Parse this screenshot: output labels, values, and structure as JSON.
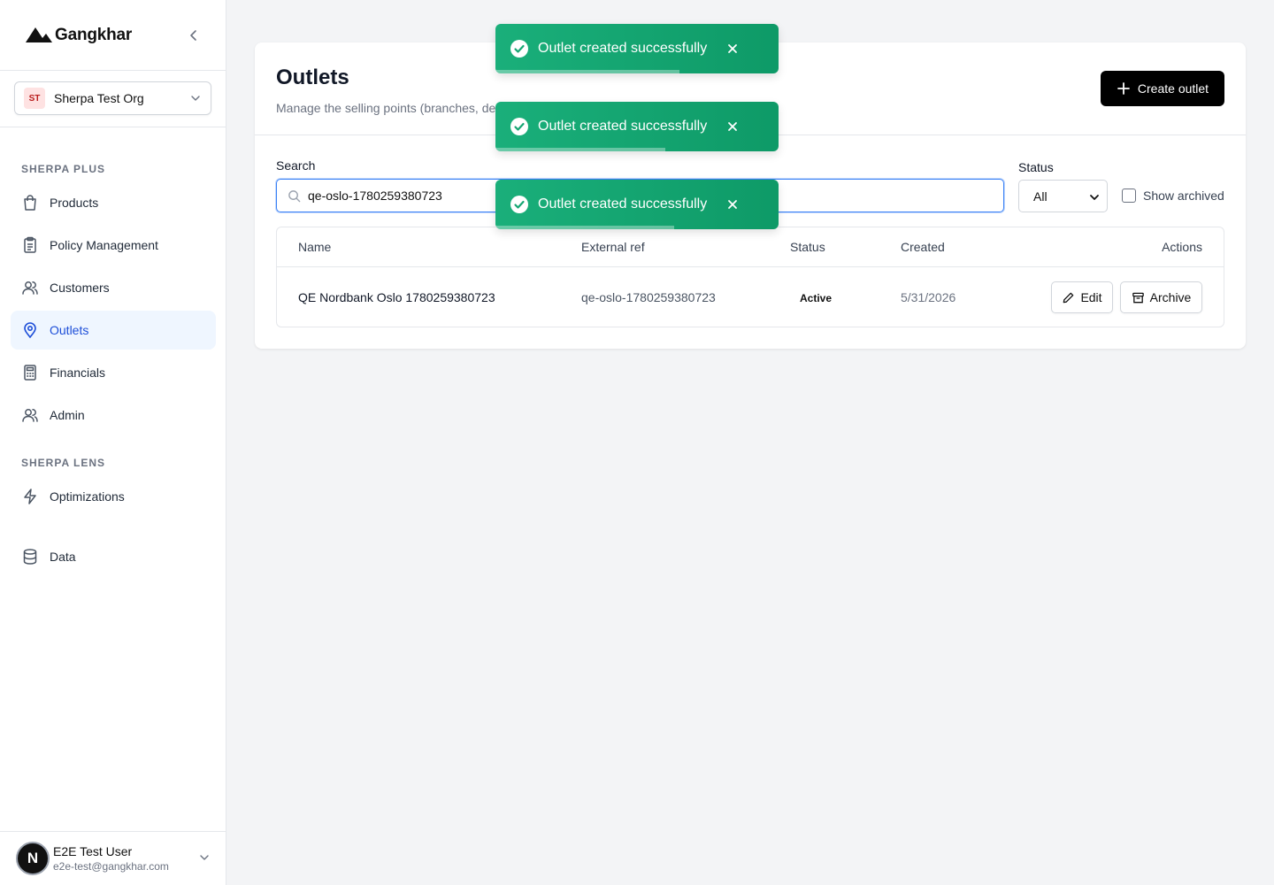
{
  "brand": {
    "name": "Gangkhar"
  },
  "org": {
    "initials": "ST",
    "name": "Sherpa Test Org"
  },
  "sidebar": {
    "sections": [
      {
        "label": "SHERPA PLUS"
      },
      {
        "label": "SHERPA LENS"
      }
    ],
    "items": [
      {
        "label": "Products",
        "icon": "shopping-bag-icon"
      },
      {
        "label": "Policy Management",
        "icon": "clipboard-icon"
      },
      {
        "label": "Customers",
        "icon": "users-icon"
      },
      {
        "label": "Outlets",
        "icon": "map-pin-icon",
        "active": true
      },
      {
        "label": "Financials",
        "icon": "calculator-icon"
      },
      {
        "label": "Admin",
        "icon": "users-icon"
      },
      {
        "label": "Optimizations",
        "icon": "lightning-icon"
      },
      {
        "label": "Data",
        "icon": "database-icon"
      }
    ]
  },
  "user": {
    "initial": "N",
    "name": "E2E Test User",
    "email": "e2e-test@gangkhar.com"
  },
  "page": {
    "title": "Outlets",
    "subtitle": "Manage the selling points (branches, de",
    "create_label": "Create outlet"
  },
  "filters": {
    "search_label": "Search",
    "search_value": "qe-oslo-1780259380723",
    "status_label": "Status",
    "status_value": "All",
    "show_archived_label": "Show archived",
    "show_archived_checked": false
  },
  "table": {
    "columns": [
      "Name",
      "External ref",
      "Status",
      "Created",
      "Actions"
    ],
    "rows": [
      {
        "name": "QE Nordbank Oslo 1780259380723",
        "external_ref": "qe-oslo-1780259380723",
        "status": "Active",
        "created": "5/31/2026",
        "edit_label": "Edit",
        "archive_label": "Archive"
      }
    ]
  },
  "toasts": [
    {
      "message": "Outlet created successfully",
      "progress": 0.65
    },
    {
      "message": "Outlet created successfully",
      "progress": 0.6
    },
    {
      "message": "Outlet created successfully",
      "progress": 0.63
    }
  ],
  "colors": {
    "accent": "#1d4ed8",
    "active_bg": "#eff6ff",
    "toast": "#16a673",
    "primary_button": "#000000"
  }
}
